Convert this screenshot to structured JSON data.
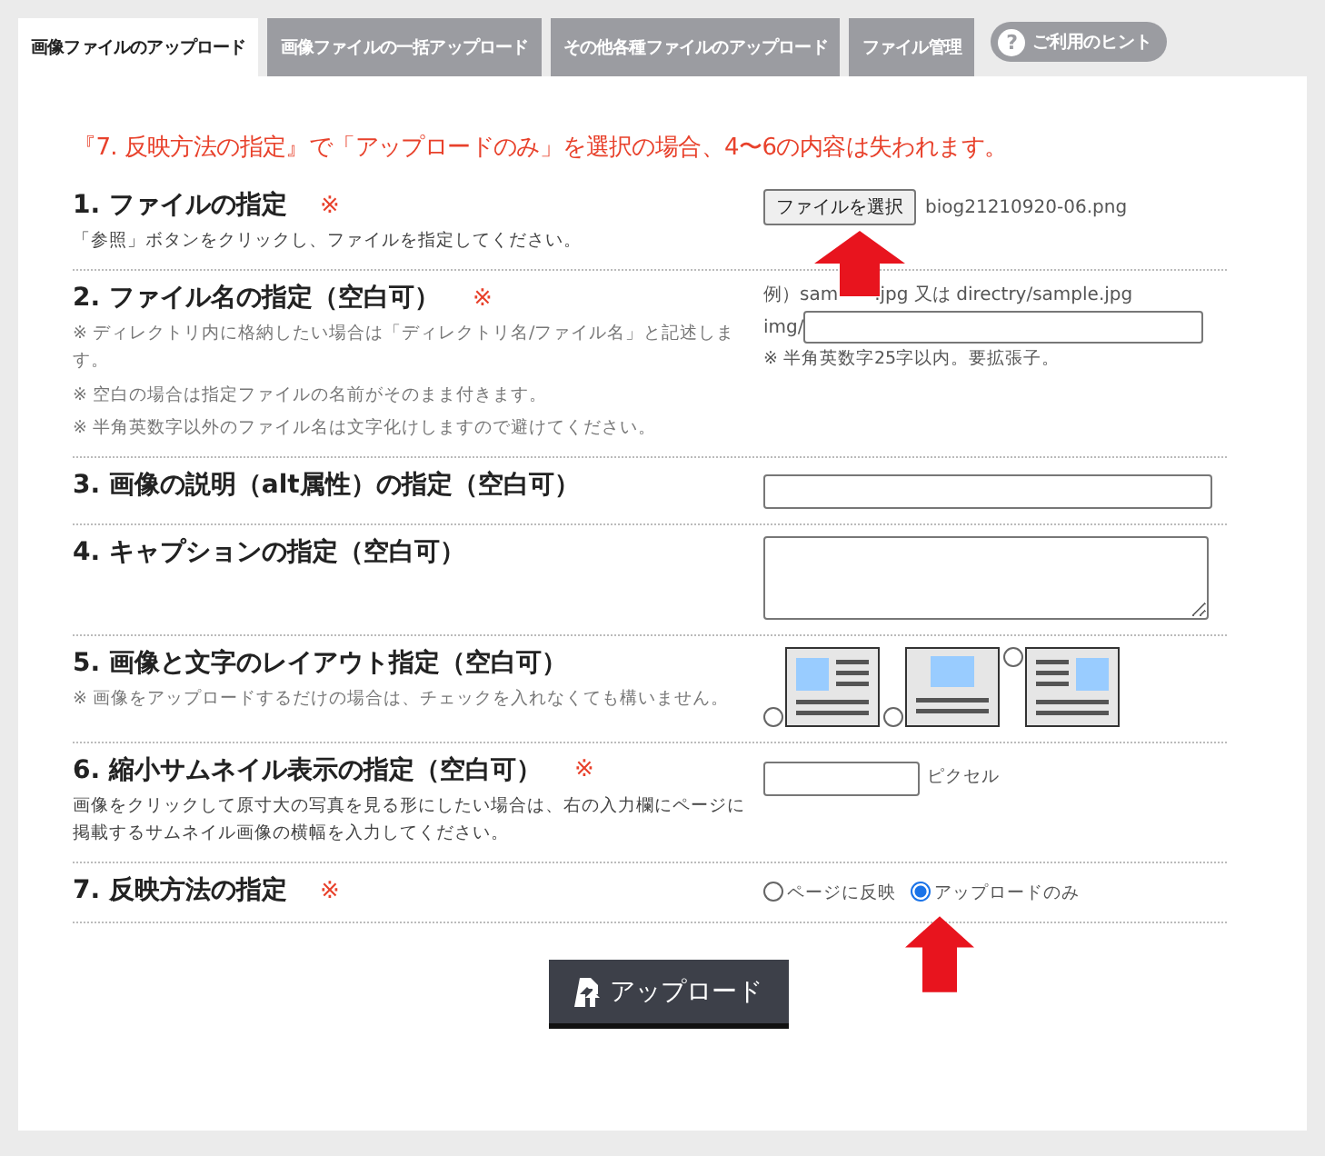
{
  "tabs": [
    {
      "label": "画像ファイルのアップロード",
      "selected": true
    },
    {
      "label": "画像ファイルの一括アップロード",
      "selected": false
    },
    {
      "label": "その他各種ファイルのアップロード",
      "selected": false
    },
    {
      "label": "ファイル管理",
      "selected": false
    }
  ],
  "hint": {
    "icon": "?",
    "label": "ご利用のヒント"
  },
  "warning": "『7. 反映方法の指定』で「アップロードのみ」を選択の場合、4〜6の内容は失われます。",
  "sections": [
    {
      "kind": "file",
      "title": "1. ファイルの指定",
      "mark": "※",
      "notes": [
        "「参照」ボタンをクリックし、ファイルを指定してください。"
      ],
      "button": "ファイルを選択",
      "filename": "biog21210920-06.png"
    },
    {
      "kind": "filename",
      "title": "2. ファイル名の指定（空白可）",
      "mark": "※",
      "notes": [
        "※ ディレクトリ内に格納したい場合は「ディレクトリ名/ファイル名」と記述します。",
        "※ 空白の場合は指定ファイルの名前がそのまま付きます。",
        "※ 半角英数字以外のファイル名は文字化けしますので避けてください。"
      ],
      "example": [
        "例）sam",
        ".jpg 又は directry/sample.jpg"
      ],
      "prefix": "img/",
      "hint": "※ 半角英数字25字以内。要拡張子。"
    },
    {
      "kind": "text",
      "title": "3. 画像の説明（alt属性）の指定（空白可）"
    },
    {
      "kind": "textarea",
      "title": "4. キャプションの指定（空白可）"
    },
    {
      "kind": "layout",
      "title": "5. 画像と文字のレイアウト指定（空白可）",
      "notes": [
        "※ 画像をアップロードするだけの場合は、チェックを入れなくても構いません。"
      ],
      "options": [
        {
          "kind": "left",
          "selected": false
        },
        {
          "kind": "top",
          "selected": false
        },
        {
          "kind": "right",
          "selected": false
        }
      ]
    },
    {
      "kind": "size",
      "title": "6. 縮小サムネイル表示の指定（空白可）",
      "mark": "※",
      "notes": [
        "画像をクリックして原寸大の写真を見る形にしたい場合は、右の入力欄にページに掲載するサムネイル画像の横幅を入力してください。"
      ],
      "unit": "ピクセル"
    },
    {
      "kind": "radio",
      "title": "7. 反映方法の指定",
      "mark": "※",
      "options": [
        {
          "label": "ページに反映",
          "selected": false
        },
        {
          "label": "アップロードのみ",
          "selected": true
        }
      ]
    }
  ],
  "submit": "アップロード"
}
